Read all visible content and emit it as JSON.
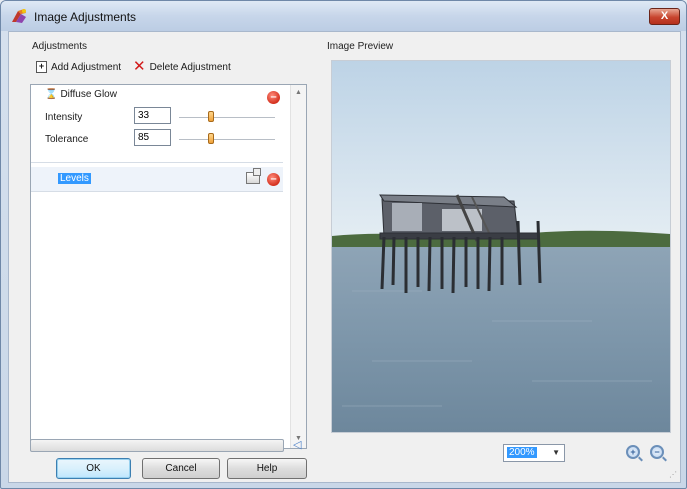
{
  "window": {
    "title": "Image Adjustments",
    "close_label": "X"
  },
  "adjustments_panel": {
    "label": "Adjustments",
    "add_label": "Add Adjustment",
    "delete_label": "Delete Adjustment",
    "items": [
      {
        "name": "Diffuse Glow",
        "params": [
          {
            "label": "Intensity",
            "value": "33",
            "level": 0.33
          },
          {
            "label": "Tolerance",
            "value": "85",
            "level": 0.33
          }
        ]
      },
      {
        "name": "Levels",
        "selected": true
      }
    ]
  },
  "preview": {
    "label": "Image Preview",
    "zoom": "200%"
  },
  "buttons": {
    "ok": "OK",
    "cancel": "Cancel",
    "help": "Help"
  },
  "colors": {
    "selection": "#3399ff",
    "remove": "#d4311f",
    "slider_thumb": "#f0a23a"
  }
}
